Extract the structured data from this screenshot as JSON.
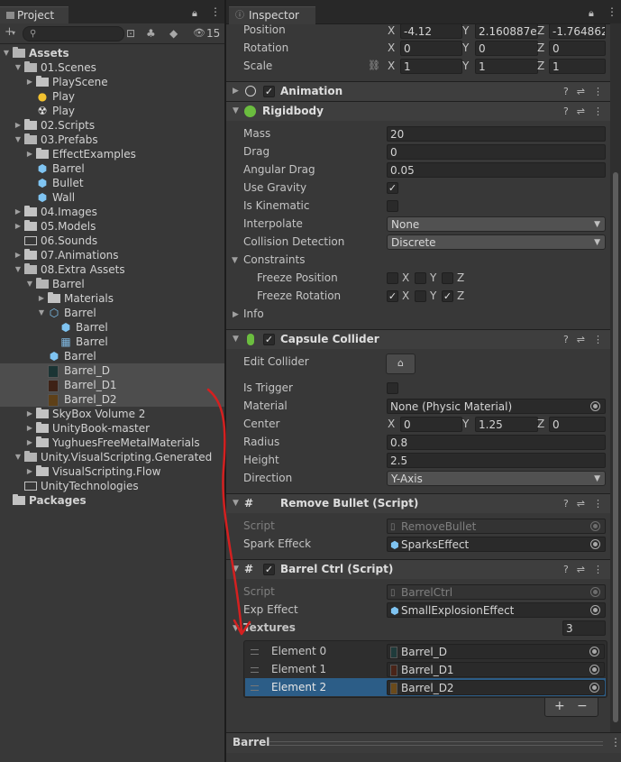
{
  "project_panel": {
    "tab_label": "Project",
    "search_placeholder": "",
    "hidden_count": "15",
    "tree": [
      {
        "label": "Assets",
        "level": 0,
        "kind": "folder-open",
        "caret": "▼",
        "bold": true
      },
      {
        "label": "01.Scenes",
        "level": 1,
        "kind": "folder-open",
        "caret": "▼"
      },
      {
        "label": "PlayScene",
        "level": 2,
        "kind": "folder",
        "caret": "▶"
      },
      {
        "label": "Play",
        "level": 2,
        "kind": "lightbulb",
        "caret": ""
      },
      {
        "label": "Play",
        "level": 2,
        "kind": "physics",
        "caret": ""
      },
      {
        "label": "02.Scripts",
        "level": 1,
        "kind": "folder",
        "caret": "▶"
      },
      {
        "label": "03.Prefabs",
        "level": 1,
        "kind": "folder-open",
        "caret": "▼"
      },
      {
        "label": "EffectExamples",
        "level": 2,
        "kind": "folder",
        "caret": "▶"
      },
      {
        "label": "Barrel",
        "level": 2,
        "kind": "prefab",
        "caret": ""
      },
      {
        "label": "Bullet",
        "level": 2,
        "kind": "prefab",
        "caret": ""
      },
      {
        "label": "Wall",
        "level": 2,
        "kind": "prefab",
        "caret": ""
      },
      {
        "label": "04.Images",
        "level": 1,
        "kind": "folder",
        "caret": "▶"
      },
      {
        "label": "05.Models",
        "level": 1,
        "kind": "folder",
        "caret": "▶"
      },
      {
        "label": "06.Sounds",
        "level": 1,
        "kind": "folder-empty",
        "caret": ""
      },
      {
        "label": "07.Animations",
        "level": 1,
        "kind": "folder",
        "caret": "▶"
      },
      {
        "label": "08.Extra Assets",
        "level": 1,
        "kind": "folder-open",
        "caret": "▼"
      },
      {
        "label": "Barrel",
        "level": 2,
        "kind": "folder-open",
        "caret": "▼"
      },
      {
        "label": "Materials",
        "level": 3,
        "kind": "folder",
        "caret": "▶"
      },
      {
        "label": "Barrel",
        "level": 3,
        "kind": "model",
        "caret": "▼"
      },
      {
        "label": "Barrel",
        "level": 4,
        "kind": "prefab",
        "caret": ""
      },
      {
        "label": "Barrel",
        "level": 4,
        "kind": "mesh",
        "caret": ""
      },
      {
        "label": "Barrel",
        "level": 3,
        "kind": "prefab",
        "caret": ""
      },
      {
        "label": "Barrel_D",
        "level": 3,
        "kind": "texture-a",
        "caret": "",
        "selected": true
      },
      {
        "label": "Barrel_D1",
        "level": 3,
        "kind": "texture-b",
        "caret": "",
        "selected": true
      },
      {
        "label": "Barrel_D2",
        "level": 3,
        "kind": "texture-c",
        "caret": "",
        "selected": true
      },
      {
        "label": "SkyBox Volume 2",
        "level": 2,
        "kind": "folder",
        "caret": "▶"
      },
      {
        "label": "UnityBook-master",
        "level": 2,
        "kind": "folder",
        "caret": "▶"
      },
      {
        "label": "YughuesFreeMetalMaterials",
        "level": 2,
        "kind": "folder",
        "caret": "▶"
      },
      {
        "label": "Unity.VisualScripting.Generated",
        "level": 1,
        "kind": "folder-open",
        "caret": "▼"
      },
      {
        "label": "VisualScripting.Flow",
        "level": 2,
        "kind": "folder",
        "caret": "▶"
      },
      {
        "label": "UnityTechnologies",
        "level": 1,
        "kind": "folder-empty",
        "caret": ""
      },
      {
        "label": "Packages",
        "level": 0,
        "kind": "folder",
        "caret": "",
        "bold": true
      }
    ]
  },
  "inspector": {
    "tab_label": "Inspector",
    "transform": {
      "position_label": "Position",
      "pos_x": "-4.12",
      "pos_y": "2.160887e",
      "pos_z": "-1.764862",
      "rotation_label": "Rotation",
      "rot_x": "0",
      "rot_y": "0",
      "rot_z": "0",
      "scale_label": "Scale",
      "scl_x": "1",
      "scl_y": "1",
      "scl_z": "1",
      "axis_x": "X",
      "axis_y": "Y",
      "axis_z": "Z"
    },
    "animation": {
      "title": "Animation"
    },
    "rigidbody": {
      "title": "Rigidbody",
      "mass_label": "Mass",
      "mass": "20",
      "drag_label": "Drag",
      "drag": "0",
      "angular_drag_label": "Angular Drag",
      "angular_drag": "0.05",
      "use_gravity_label": "Use Gravity",
      "use_gravity": true,
      "is_kinematic_label": "Is Kinematic",
      "is_kinematic": false,
      "interpolate_label": "Interpolate",
      "interpolate": "None",
      "collision_label": "Collision Detection",
      "collision": "Discrete",
      "constraints_label": "Constraints",
      "freeze_pos_label": "Freeze Position",
      "freeze_rot_label": "Freeze Rotation",
      "info_label": "Info"
    },
    "capsule": {
      "title": "Capsule Collider",
      "edit_label": "Edit Collider",
      "trigger_label": "Is Trigger",
      "material_label": "Material",
      "material": "None (Physic Material)",
      "center_label": "Center",
      "c_x": "0",
      "c_y": "1.25",
      "c_z": "0",
      "radius_label": "Radius",
      "radius": "0.8",
      "height_label": "Height",
      "height": "2.5",
      "direction_label": "Direction",
      "direction": "Y-Axis"
    },
    "remove_bullet": {
      "title": "Remove Bullet (Script)",
      "script_label": "Script",
      "script": "RemoveBullet",
      "spark_label": "Spark Effeck",
      "spark": "SparksEffect"
    },
    "barrel_ctrl": {
      "title": "Barrel Ctrl (Script)",
      "script_label": "Script",
      "script": "BarrelCtrl",
      "exp_label": "Exp Effect",
      "exp": "SmallExplosionEffect",
      "textures_label": "Textures",
      "textures_count": "3",
      "elements": [
        {
          "label": "Element 0",
          "value": "Barrel_D"
        },
        {
          "label": "Element 1",
          "value": "Barrel_D1"
        },
        {
          "label": "Element 2",
          "value": "Barrel_D2"
        }
      ],
      "plus": "+",
      "minus": "−"
    },
    "bottom_label": "Barrel"
  }
}
